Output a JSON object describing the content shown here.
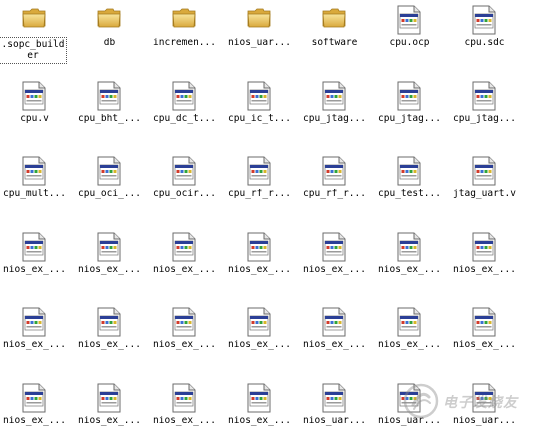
{
  "window": {
    "view": "icons"
  },
  "colors": {
    "folder_light": "#f8e59c",
    "folder_dark": "#d9a93c",
    "doc_border": "#6b6b6b",
    "doc_titlebar": "#2b3f96",
    "selection_outline": "#555555"
  },
  "files": [
    {
      "name": ".sopc_builder",
      "icon": "folder-icon",
      "selected": true
    },
    {
      "name": "db",
      "icon": "folder-icon"
    },
    {
      "name": "incremen...",
      "icon": "folder-icon"
    },
    {
      "name": "nios_uar...",
      "icon": "folder-icon"
    },
    {
      "name": "software",
      "icon": "folder-icon"
    },
    {
      "name": "cpu.ocp",
      "icon": "document-icon"
    },
    {
      "name": "cpu.sdc",
      "icon": "document-icon"
    },
    {
      "name": "cpu.v",
      "icon": "document-icon"
    },
    {
      "name": "cpu_bht_...",
      "icon": "document-icon"
    },
    {
      "name": "cpu_dc_t...",
      "icon": "document-icon"
    },
    {
      "name": "cpu_ic_t...",
      "icon": "document-icon"
    },
    {
      "name": "cpu_jtag...",
      "icon": "document-icon"
    },
    {
      "name": "cpu_jtag...",
      "icon": "document-icon"
    },
    {
      "name": "cpu_jtag...",
      "icon": "document-icon"
    },
    {
      "name": "cpu_mult...",
      "icon": "document-icon"
    },
    {
      "name": "cpu_oci_...",
      "icon": "document-icon"
    },
    {
      "name": "cpu_ocir...",
      "icon": "document-icon"
    },
    {
      "name": "cpu_rf_r...",
      "icon": "document-icon"
    },
    {
      "name": "cpu_rf_r...",
      "icon": "document-icon"
    },
    {
      "name": "cpu_test...",
      "icon": "document-icon"
    },
    {
      "name": "jtag_uart.v",
      "icon": "document-icon"
    },
    {
      "name": "nios_ex_...",
      "icon": "document-icon"
    },
    {
      "name": "nios_ex_...",
      "icon": "document-icon"
    },
    {
      "name": "nios_ex_...",
      "icon": "document-icon"
    },
    {
      "name": "nios_ex_...",
      "icon": "document-icon"
    },
    {
      "name": "nios_ex_...",
      "icon": "document-icon"
    },
    {
      "name": "nios_ex_...",
      "icon": "document-icon"
    },
    {
      "name": "nios_ex_...",
      "icon": "document-icon"
    },
    {
      "name": "nios_ex_...",
      "icon": "document-icon"
    },
    {
      "name": "nios_ex_...",
      "icon": "document-icon"
    },
    {
      "name": "nios_ex_...",
      "icon": "document-icon"
    },
    {
      "name": "nios_ex_...",
      "icon": "document-icon"
    },
    {
      "name": "nios_ex_...",
      "icon": "document-icon"
    },
    {
      "name": "nios_ex_...",
      "icon": "document-icon"
    },
    {
      "name": "nios_ex_...",
      "icon": "document-icon"
    },
    {
      "name": "nios_ex_...",
      "icon": "document-icon"
    },
    {
      "name": "nios_ex_...",
      "icon": "document-icon"
    },
    {
      "name": "nios_ex_...",
      "icon": "document-icon"
    },
    {
      "name": "nios_ex_...",
      "icon": "document-icon"
    },
    {
      "name": "nios_uar...",
      "icon": "document-icon"
    },
    {
      "name": "nios_uar...",
      "icon": "document-icon"
    },
    {
      "name": "nios_uar...",
      "icon": "document-icon"
    }
  ],
  "watermark": {
    "text": "电子发烧友",
    "icon": "watermark-logo-icon"
  }
}
